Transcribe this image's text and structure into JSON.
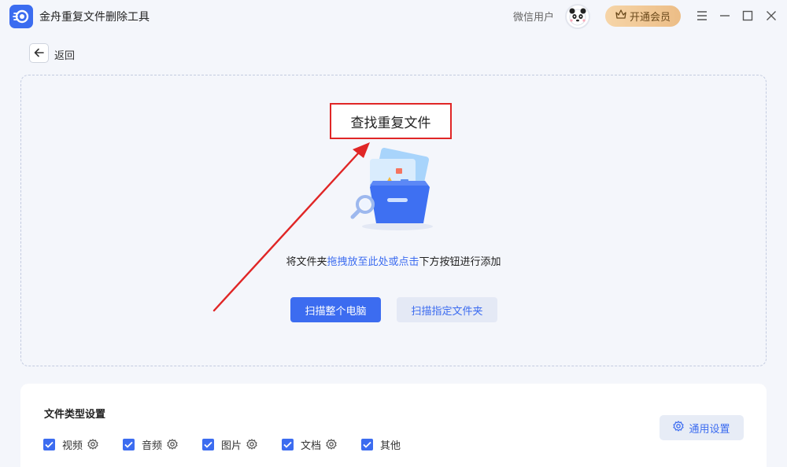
{
  "app": {
    "title": "金舟重复文件删除工具"
  },
  "header": {
    "user_name": "微信用户",
    "vip_label": "开通会员"
  },
  "nav": {
    "back_label": "返回"
  },
  "main": {
    "title": "查找重复文件",
    "drop_prefix": "将文件夹",
    "drop_link": "拖拽放至此处或点击",
    "drop_suffix": "下方按钮进行添加",
    "scan_pc_label": "扫描整个电脑",
    "scan_folder_label": "扫描指定文件夹"
  },
  "settings": {
    "title": "文件类型设置",
    "general_label": "通用设置",
    "types": [
      {
        "label": "视频",
        "checked": true,
        "has_settings": true
      },
      {
        "label": "音频",
        "checked": true,
        "has_settings": true
      },
      {
        "label": "图片",
        "checked": true,
        "has_settings": true
      },
      {
        "label": "文档",
        "checked": true,
        "has_settings": true
      },
      {
        "label": "其他",
        "checked": true,
        "has_settings": false
      }
    ]
  },
  "colors": {
    "accent": "#3c6cf0",
    "annotation": "#e02626",
    "vip": "#ecbd86"
  },
  "icons": [
    "app-logo-icon",
    "crown-icon",
    "menu-icon",
    "minimize-icon",
    "maximize-icon",
    "close-icon",
    "back-arrow-icon",
    "folder-search-illustration",
    "check-icon",
    "gear-icon"
  ]
}
